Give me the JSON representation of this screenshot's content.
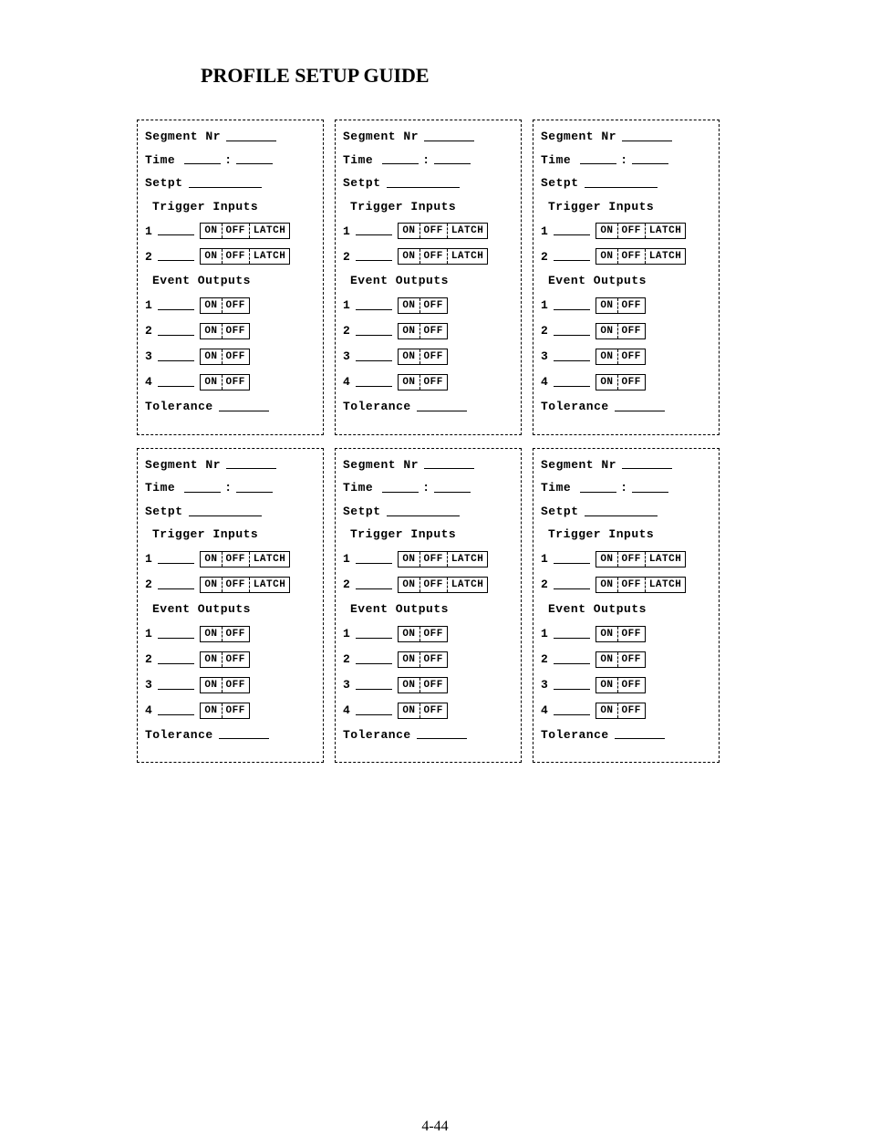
{
  "title": "PROFILE SETUP GUIDE",
  "page_number": "4-44",
  "labels": {
    "segment_nr": "Segment Nr",
    "time": "Time",
    "time_sep": ":",
    "setpt": "Setpt",
    "trigger_inputs": "Trigger Inputs",
    "event_outputs": "Event Outputs",
    "tolerance": "Tolerance",
    "on": "ON",
    "off": "OFF",
    "latch": "LATCH",
    "n1": "1",
    "n2": "2",
    "n3": "3",
    "n4": "4"
  }
}
